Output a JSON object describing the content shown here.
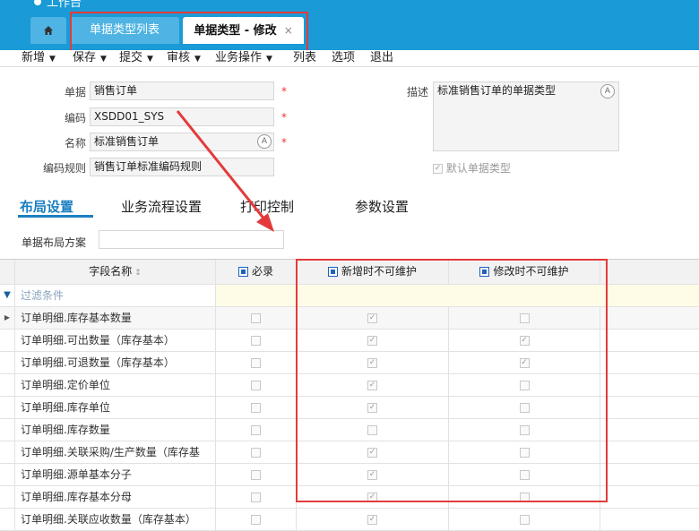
{
  "window": {
    "logo_text": "工作台"
  },
  "tabs": {
    "list_label": "单据类型列表",
    "edit_label": "单据类型 - 修改",
    "close_glyph": "×"
  },
  "toolbar": {
    "new": "新增",
    "save": "保存",
    "submit": "提交",
    "audit": "审核",
    "business": "业务操作",
    "list": "列表",
    "options": "选项",
    "exit": "退出"
  },
  "form": {
    "doc_label": "单据",
    "doc_value": "销售订单",
    "code_label": "编码",
    "code_value": "XSDD01_SYS",
    "name_label": "名称",
    "name_value": "标准销售订单",
    "rule_label": "编码规则",
    "rule_value": "销售订单标准编码规则",
    "desc_label": "描述",
    "desc_value": "标准销售订单的单据类型",
    "default_label": "默认单据类型",
    "required_mark": "*"
  },
  "subtabs": {
    "layout": "布局设置",
    "flow": "业务流程设置",
    "print": "打印控制",
    "params": "参数设置"
  },
  "layout_scheme": {
    "label": "单据布局方案",
    "value": ""
  },
  "grid": {
    "headers": {
      "field": "字段名称",
      "required": "必录",
      "add_lock": "新增时不可维护",
      "edit_lock": "修改时不可维护"
    },
    "filter_label": "过滤条件",
    "rows": [
      {
        "name": "订单明细.库存基本数量",
        "required": false,
        "add_lock": true,
        "edit_lock": false
      },
      {
        "name": "订单明细.可出数量（库存基本）",
        "required": false,
        "add_lock": true,
        "edit_lock": true
      },
      {
        "name": "订单明细.可退数量（库存基本）",
        "required": false,
        "add_lock": true,
        "edit_lock": true
      },
      {
        "name": "订单明细.定价单位",
        "required": false,
        "add_lock": true,
        "edit_lock": false
      },
      {
        "name": "订单明细.库存单位",
        "required": false,
        "add_lock": true,
        "edit_lock": false
      },
      {
        "name": "订单明细.库存数量",
        "required": false,
        "add_lock": false,
        "edit_lock": false
      },
      {
        "name": "订单明细.关联采购/生产数量（库存基",
        "required": false,
        "add_lock": true,
        "edit_lock": false
      },
      {
        "name": "订单明细.源单基本分子",
        "required": false,
        "add_lock": true,
        "edit_lock": false
      },
      {
        "name": "订单明细.库存基本分母",
        "required": false,
        "add_lock": true,
        "edit_lock": false
      },
      {
        "name": "订单明细.关联应收数量（库存基本）",
        "required": false,
        "add_lock": true,
        "edit_lock": false
      }
    ]
  },
  "colors": {
    "brand": "#1a9ad6",
    "highlight": "#e33b3b",
    "accent": "#1a7fc1"
  }
}
